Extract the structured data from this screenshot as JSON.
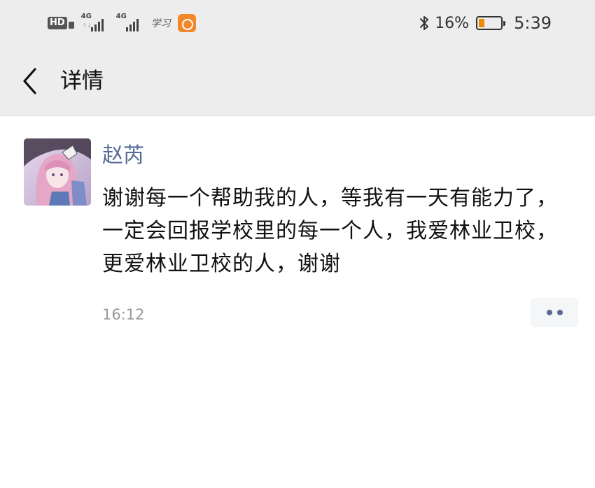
{
  "status_bar": {
    "hd_label": "HD",
    "signal_1_label": "4G",
    "signal_2_label": "4G",
    "app_badge_label": "学习",
    "battery_percent": "16%",
    "battery_level": 0.16,
    "battery_fill_color": "#f08a00",
    "time": "5:39"
  },
  "header": {
    "back_icon": "chevron-left-icon",
    "title": "详情"
  },
  "post": {
    "author": "赵芮",
    "author_color": "#576b95",
    "text": "谢谢每一个帮助我的人，等我有一天有能力了，一定会回报学校里的每一个人，我爱林业卫校，更爱林业卫校的人，谢谢",
    "time": "16:12",
    "more_icon": "more-dots-icon"
  }
}
